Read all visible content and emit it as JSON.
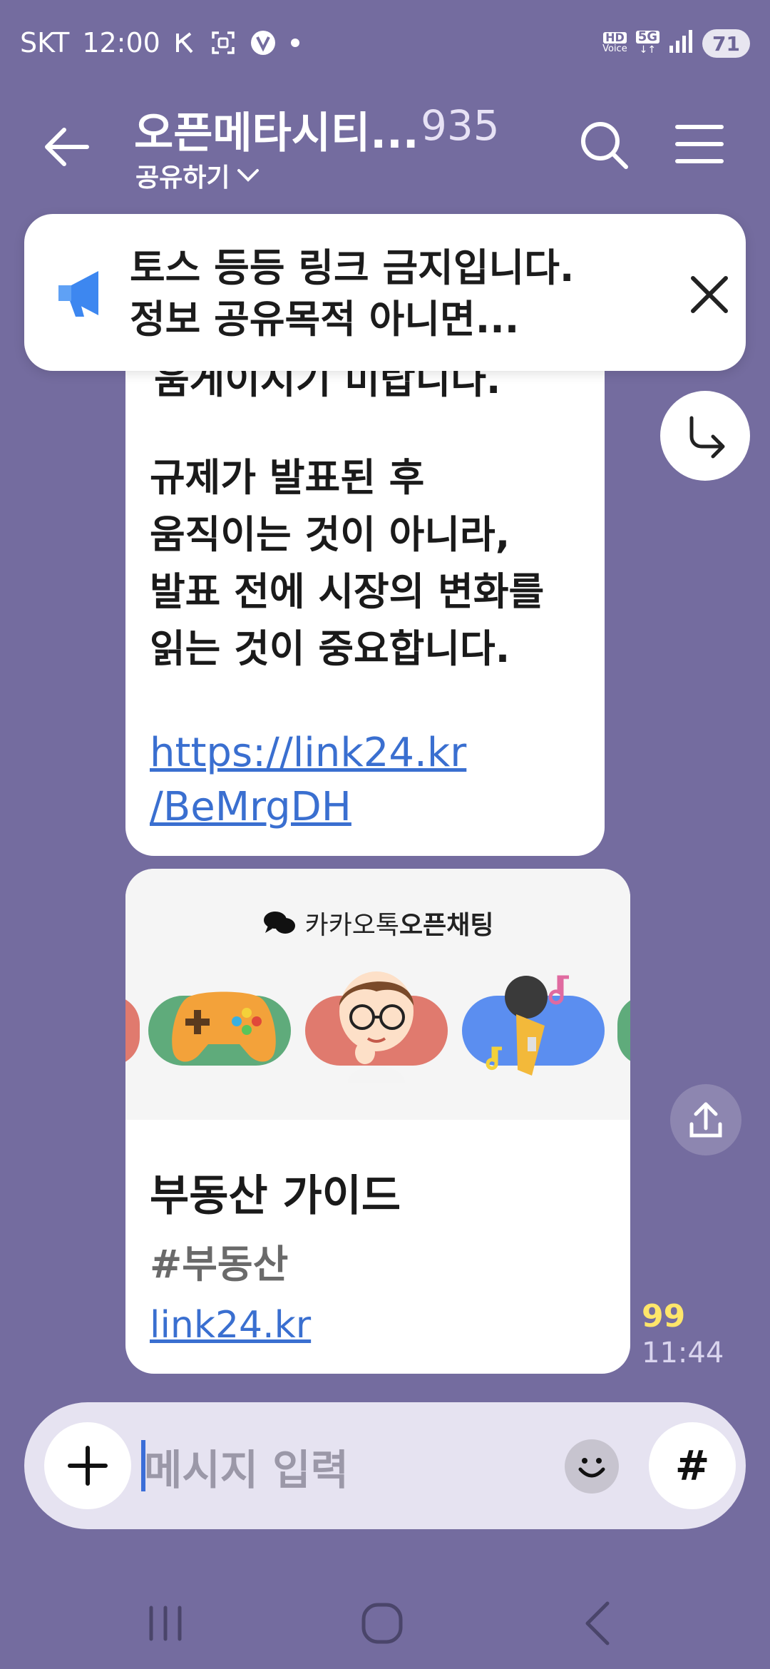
{
  "status_bar": {
    "carrier": "SKT",
    "time": "12:00",
    "hd_voice_top": "HD",
    "hd_voice_bottom": "Voice",
    "network": "5G",
    "battery": "71"
  },
  "header": {
    "title": "오픈메타시티...",
    "member_count": "935",
    "share_label": "공유하기"
  },
  "notice": {
    "line1": "토스 등등 링크 금지입니다.",
    "line2": "정보 공유목적 아니면..."
  },
  "message": {
    "cut_text": "움게이시기 미랍니다.",
    "lines": [
      "규제가 발표된 후",
      "움직이는 것이 아니라,",
      "발표 전에 시장의 변화를",
      "읽는 것이 중요합니다."
    ],
    "link_line1": "https://link24.kr",
    "link_line2": "/BeMrgDH"
  },
  "card": {
    "brand_prefix": "카카오톡",
    "brand_bold": "오픈채팅",
    "title": "부동산 가이드",
    "tag": "#부동산",
    "link": "link24.kr",
    "colors": {
      "pill_green": "#5fab7b",
      "pill_red": "#e07a6e",
      "pill_blue": "#5b8ef0"
    }
  },
  "meta": {
    "unread": "99",
    "time": "11:44"
  },
  "input": {
    "placeholder": "메시지 입력",
    "hash": "#"
  }
}
